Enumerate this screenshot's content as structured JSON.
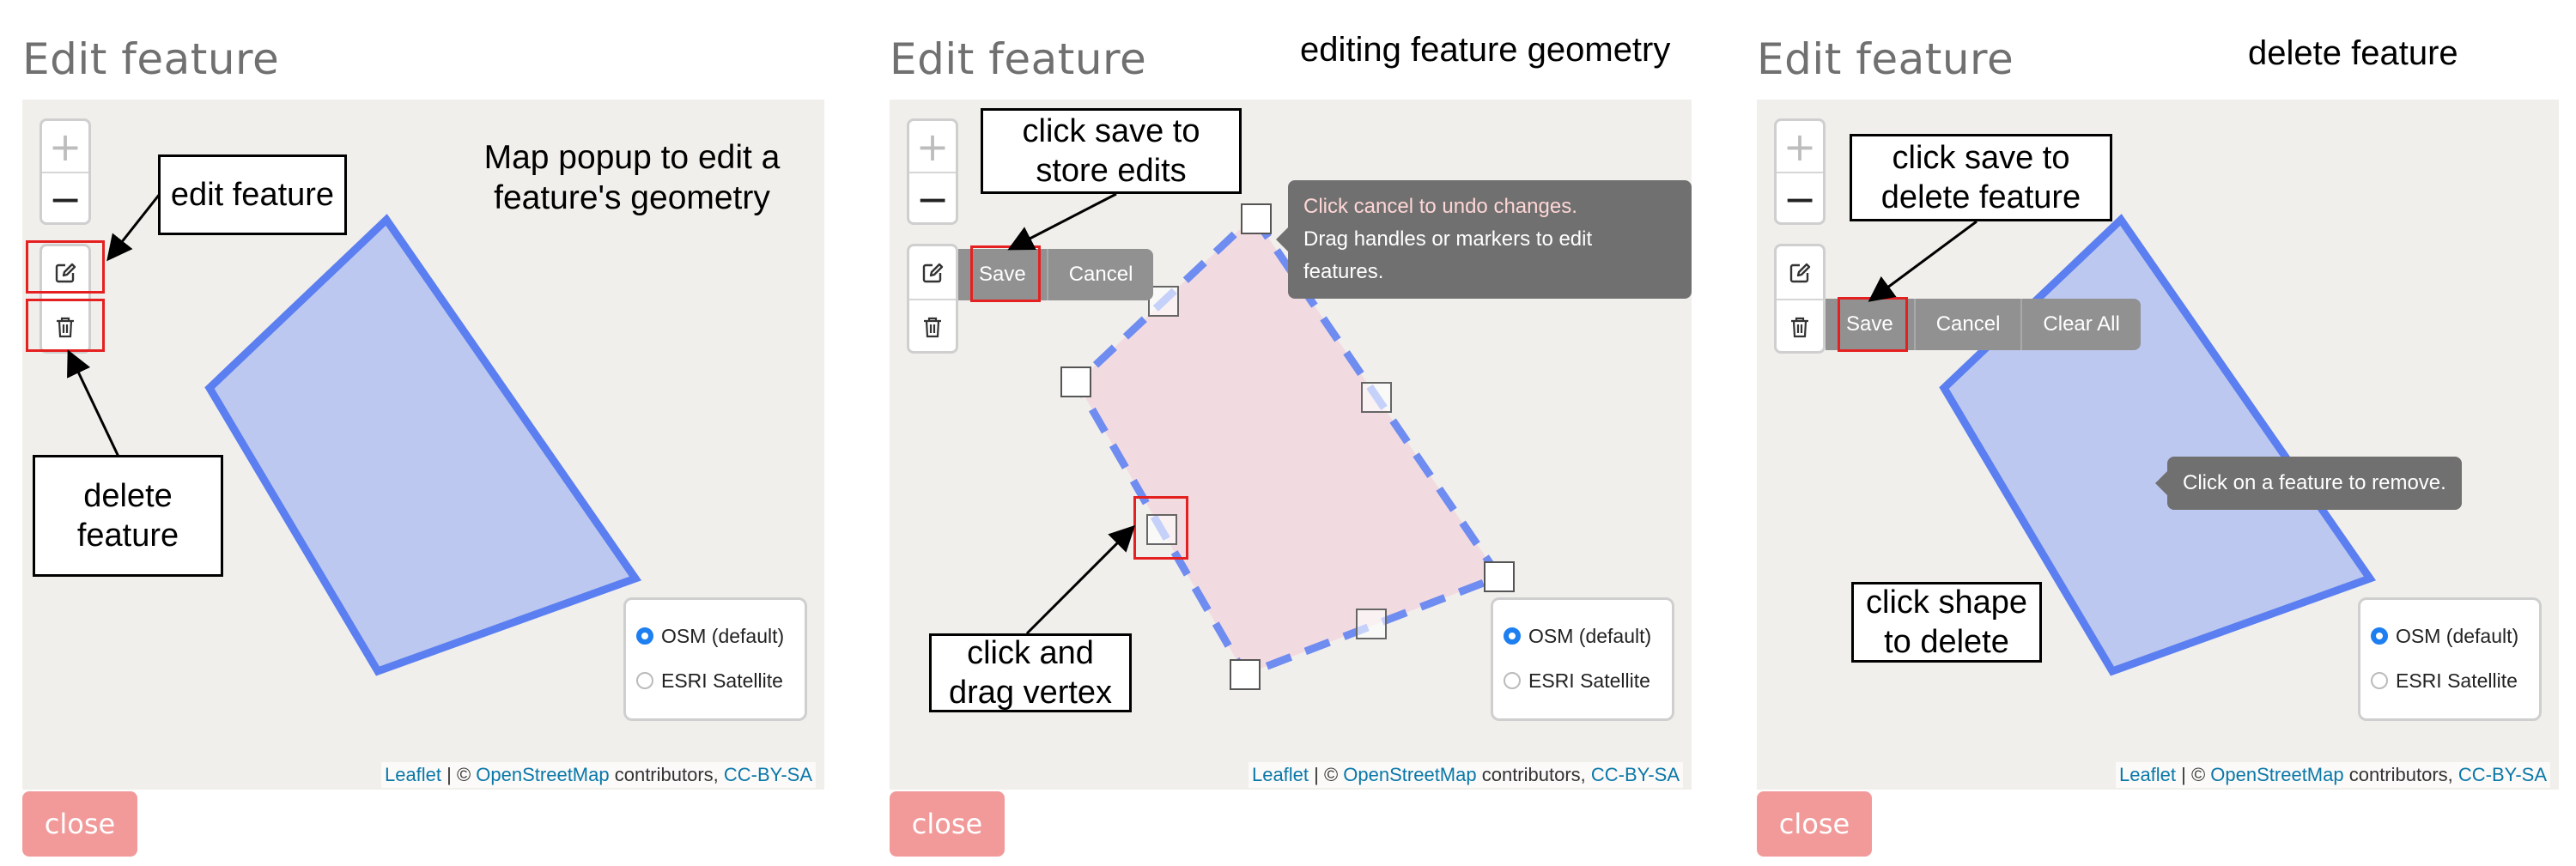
{
  "panels": [
    {
      "title": "Edit feature",
      "heading": "",
      "description": "Map popup to edit a feature's geometry",
      "callouts": {
        "edit": "edit feature",
        "delete": "delete feature"
      },
      "layers": [
        "OSM (default)",
        "ESRI Satellite"
      ],
      "selected_layer": "OSM (default)",
      "close_label": "close"
    },
    {
      "title": "Edit feature",
      "heading": "editing feature geometry",
      "actions": [
        "Save",
        "Cancel"
      ],
      "tooltip": {
        "line1": "Click cancel to undo changes.",
        "line2": "Drag handles or markers to edit features."
      },
      "callouts": {
        "save": "click save to store edits",
        "drag": "click and drag vertex"
      },
      "layers": [
        "OSM (default)",
        "ESRI Satellite"
      ],
      "selected_layer": "OSM (default)",
      "close_label": "close"
    },
    {
      "title": "Edit feature",
      "heading": "delete feature",
      "actions": [
        "Save",
        "Cancel",
        "Clear All"
      ],
      "tooltip": {
        "line1": "Click on a feature to remove."
      },
      "callouts": {
        "save": "click save to delete feature",
        "shape": "click shape to delete"
      },
      "layers": [
        "OSM (default)",
        "ESRI Satellite"
      ],
      "selected_layer": "OSM (default)",
      "close_label": "close"
    }
  ],
  "attribution": {
    "leaflet": "Leaflet",
    "sep": " | © ",
    "osm": "OpenStreetMap",
    "contrib": " contributors, ",
    "license": "CC-BY-SA"
  },
  "colors": {
    "polygon": "#5b7ff0",
    "polygon_fill": "#bcc8f0",
    "edit_fill": "#f2dbe0",
    "highlight": "#e52020",
    "close": "#f29a9a"
  }
}
